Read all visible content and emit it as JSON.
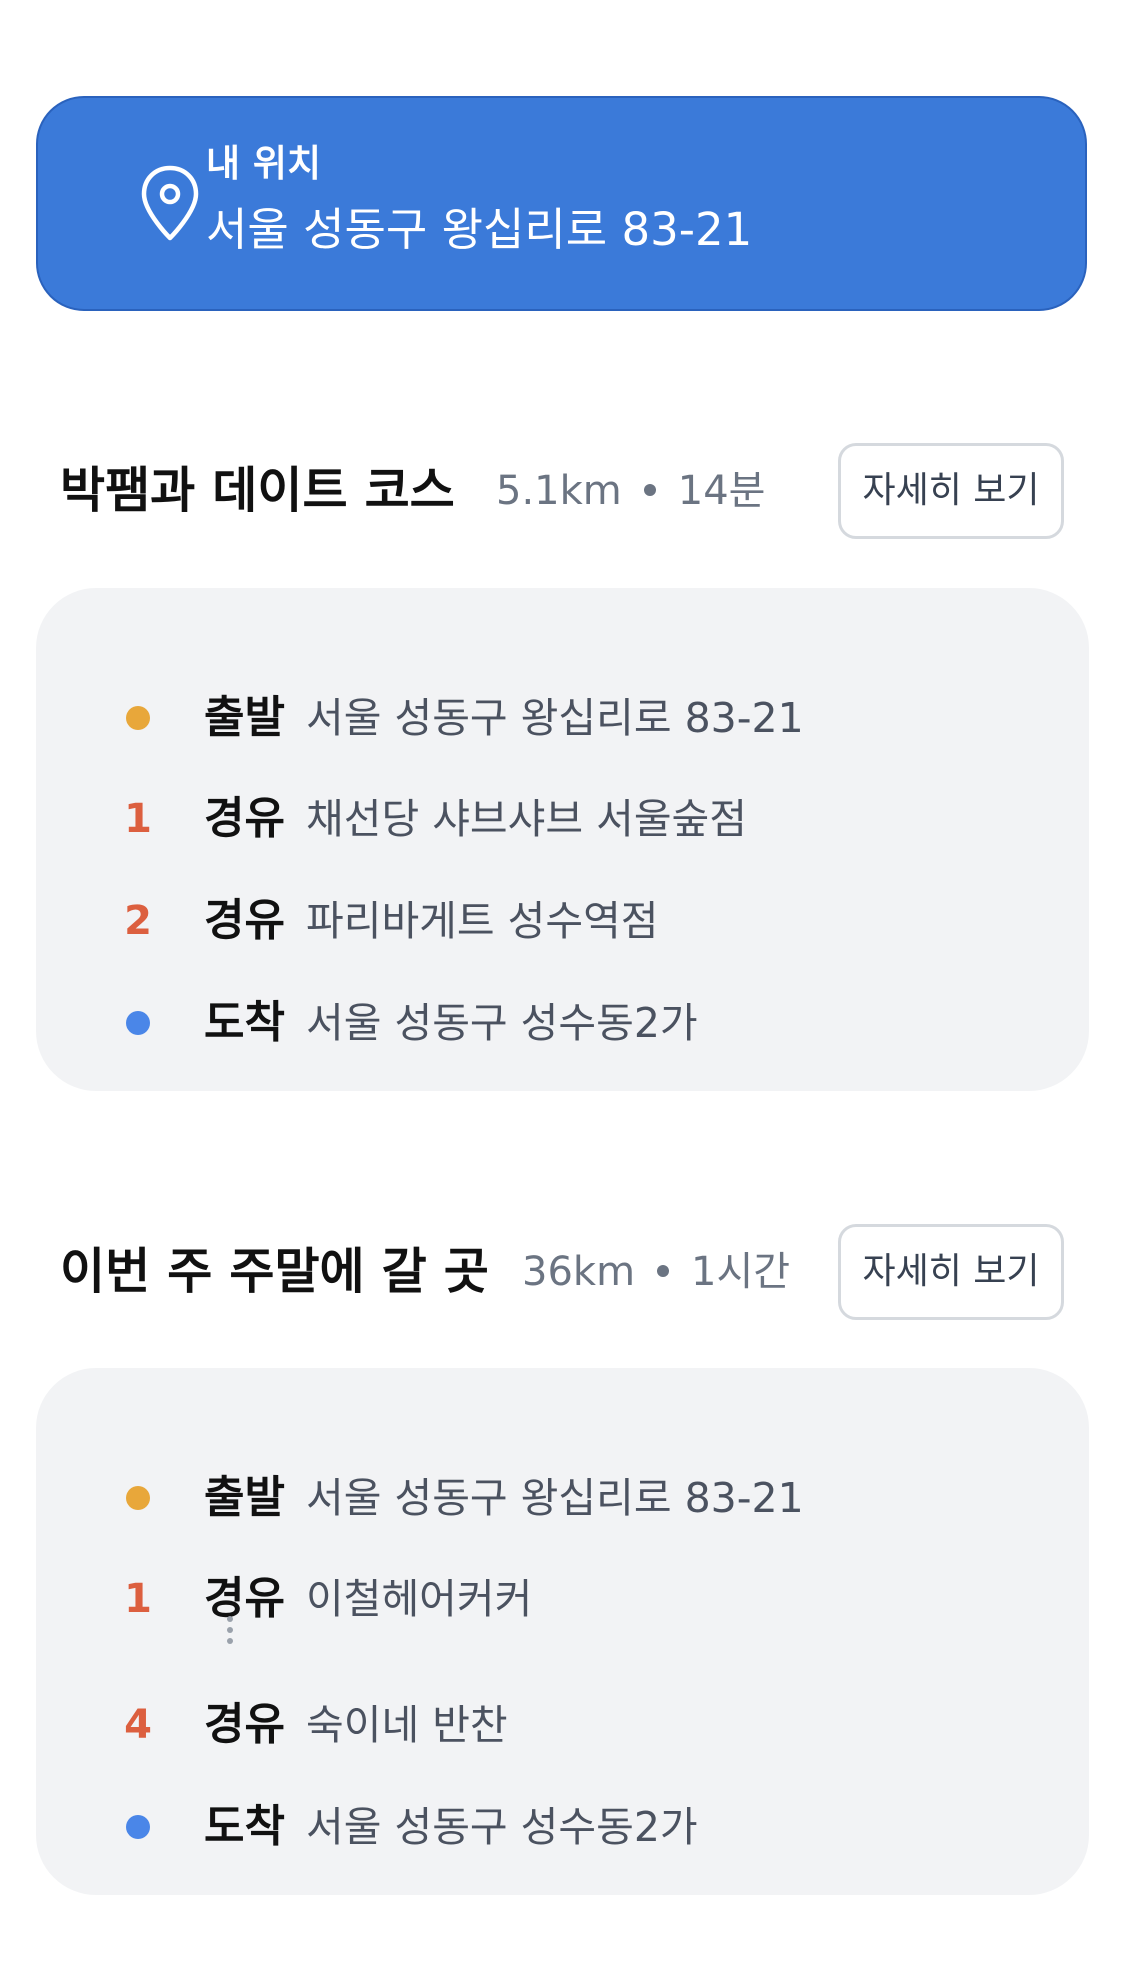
{
  "location": {
    "label": "내 위치",
    "address": "서울 성동구 왕십리로 83-21",
    "icon": "location-pin-icon"
  },
  "courses": [
    {
      "title": "박팸과 데이트 코스",
      "distance": "5.1km",
      "duration": "14분",
      "detail_label": "자세히 보기",
      "stops": [
        {
          "marker": "dot",
          "color": "#e8a73a",
          "label": "출발",
          "value": "서울 성동구 왕십리로 83-21"
        },
        {
          "marker": "1",
          "label": "경유",
          "value": "채선당 샤브샤브 서울숲점"
        },
        {
          "marker": "2",
          "label": "경유",
          "value": "파리바게트 성수역점"
        },
        {
          "marker": "dot",
          "color": "#4a86e8",
          "label": "도착",
          "value": "서울 성동구 성수동2가"
        }
      ]
    },
    {
      "title": "이번 주 주말에 갈 곳",
      "distance": "36km",
      "duration": "1시간",
      "detail_label": "자세히 보기",
      "stops": [
        {
          "marker": "dot",
          "color": "#e8a73a",
          "label": "출발",
          "value": "서울 성동구 왕십리로 83-21"
        },
        {
          "marker": "1",
          "label": "경유",
          "value": "이철헤어커커"
        },
        {
          "marker": "4",
          "label": "경유",
          "value": "숙이네 반찬"
        },
        {
          "marker": "dot",
          "color": "#4a86e8",
          "label": "도착",
          "value": "서울 성동구 성수동2가"
        }
      ],
      "collapsed_indicator": "vertical-ellipsis-icon"
    }
  ],
  "colors": {
    "banner": "#3b7ad9",
    "start_dot": "#e8a73a",
    "end_dot": "#4a86e8",
    "waypoint_number": "#dc5f3f",
    "card_background": "#f2f3f5"
  }
}
